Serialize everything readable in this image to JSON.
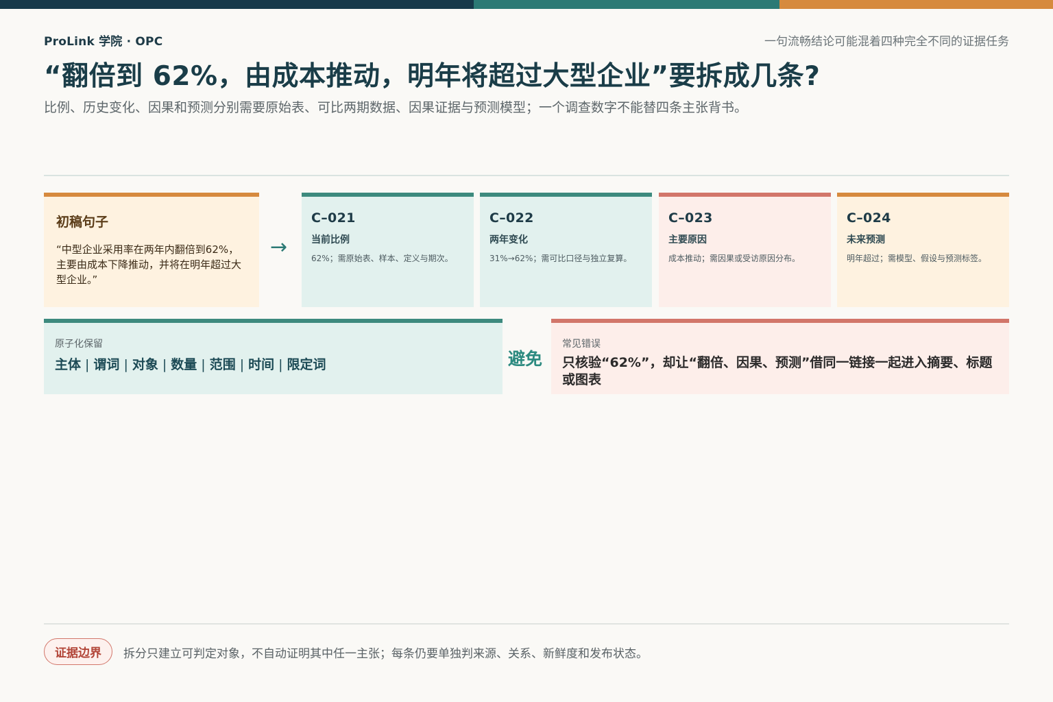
{
  "colors": {
    "bar_dark": "#17394a",
    "bar_teal": "#2c7a75",
    "bar_orange": "#d68a3e",
    "teal_bg": "#e2f1ee",
    "teal_border": "#3d8a7e",
    "red_bg": "#fdeeea",
    "red_border": "#d2766a",
    "orange_bg": "#fef2e0",
    "orange_border": "#d68a3e"
  },
  "header": {
    "brand": "ProLink 学院 · OPC",
    "tagline": "一句流畅结论可能混着四种完全不同的证据任务",
    "title": "“翻倍到 62%，由成本推动，明年将超过大型企业”要拆成几条?",
    "subtitle": "比例、历史变化、因果和预测分别需要原始表、可比两期数据、因果证据与预测模型；一个调查数字不能替四条主张背书。"
  },
  "draft": {
    "title": "初稿句子",
    "quote": "“中型企业采用率在两年内翻倍到62%，主要由成本下降推动，并将在明年超过大型企业。”"
  },
  "arrow_icon": "→",
  "claims": [
    {
      "id": "C–021",
      "name": "当前比例",
      "desc": "62%；需原始表、样本、定义与期次。",
      "theme": "teal"
    },
    {
      "id": "C–022",
      "name": "两年变化",
      "desc": "31%→62%；需可比口径与独立复算。",
      "theme": "teal"
    },
    {
      "id": "C–023",
      "name": "主要原因",
      "desc": "成本推动；需因果或受访原因分布。",
      "theme": "red"
    },
    {
      "id": "C–024",
      "name": "未来预测",
      "desc": "明年超过；需模型、假设与预测标签。",
      "theme": "orange"
    }
  ],
  "atomic": {
    "label": "原子化保留",
    "items": [
      "主体",
      "谓词",
      "对象",
      "数量",
      "范围",
      "时间",
      "限定词"
    ]
  },
  "avoid_label": "避免",
  "mistake": {
    "label": "常见错误",
    "text": "只核验“62%”，却让“翻倍、因果、预测”借同一链接一起进入摘要、标题或图表"
  },
  "boundary": {
    "badge": "证据边界",
    "text": "拆分只建立可判定对象，不自动证明其中任一主张；每条仍要单独判来源、关系、新鲜度和发布状态。"
  }
}
